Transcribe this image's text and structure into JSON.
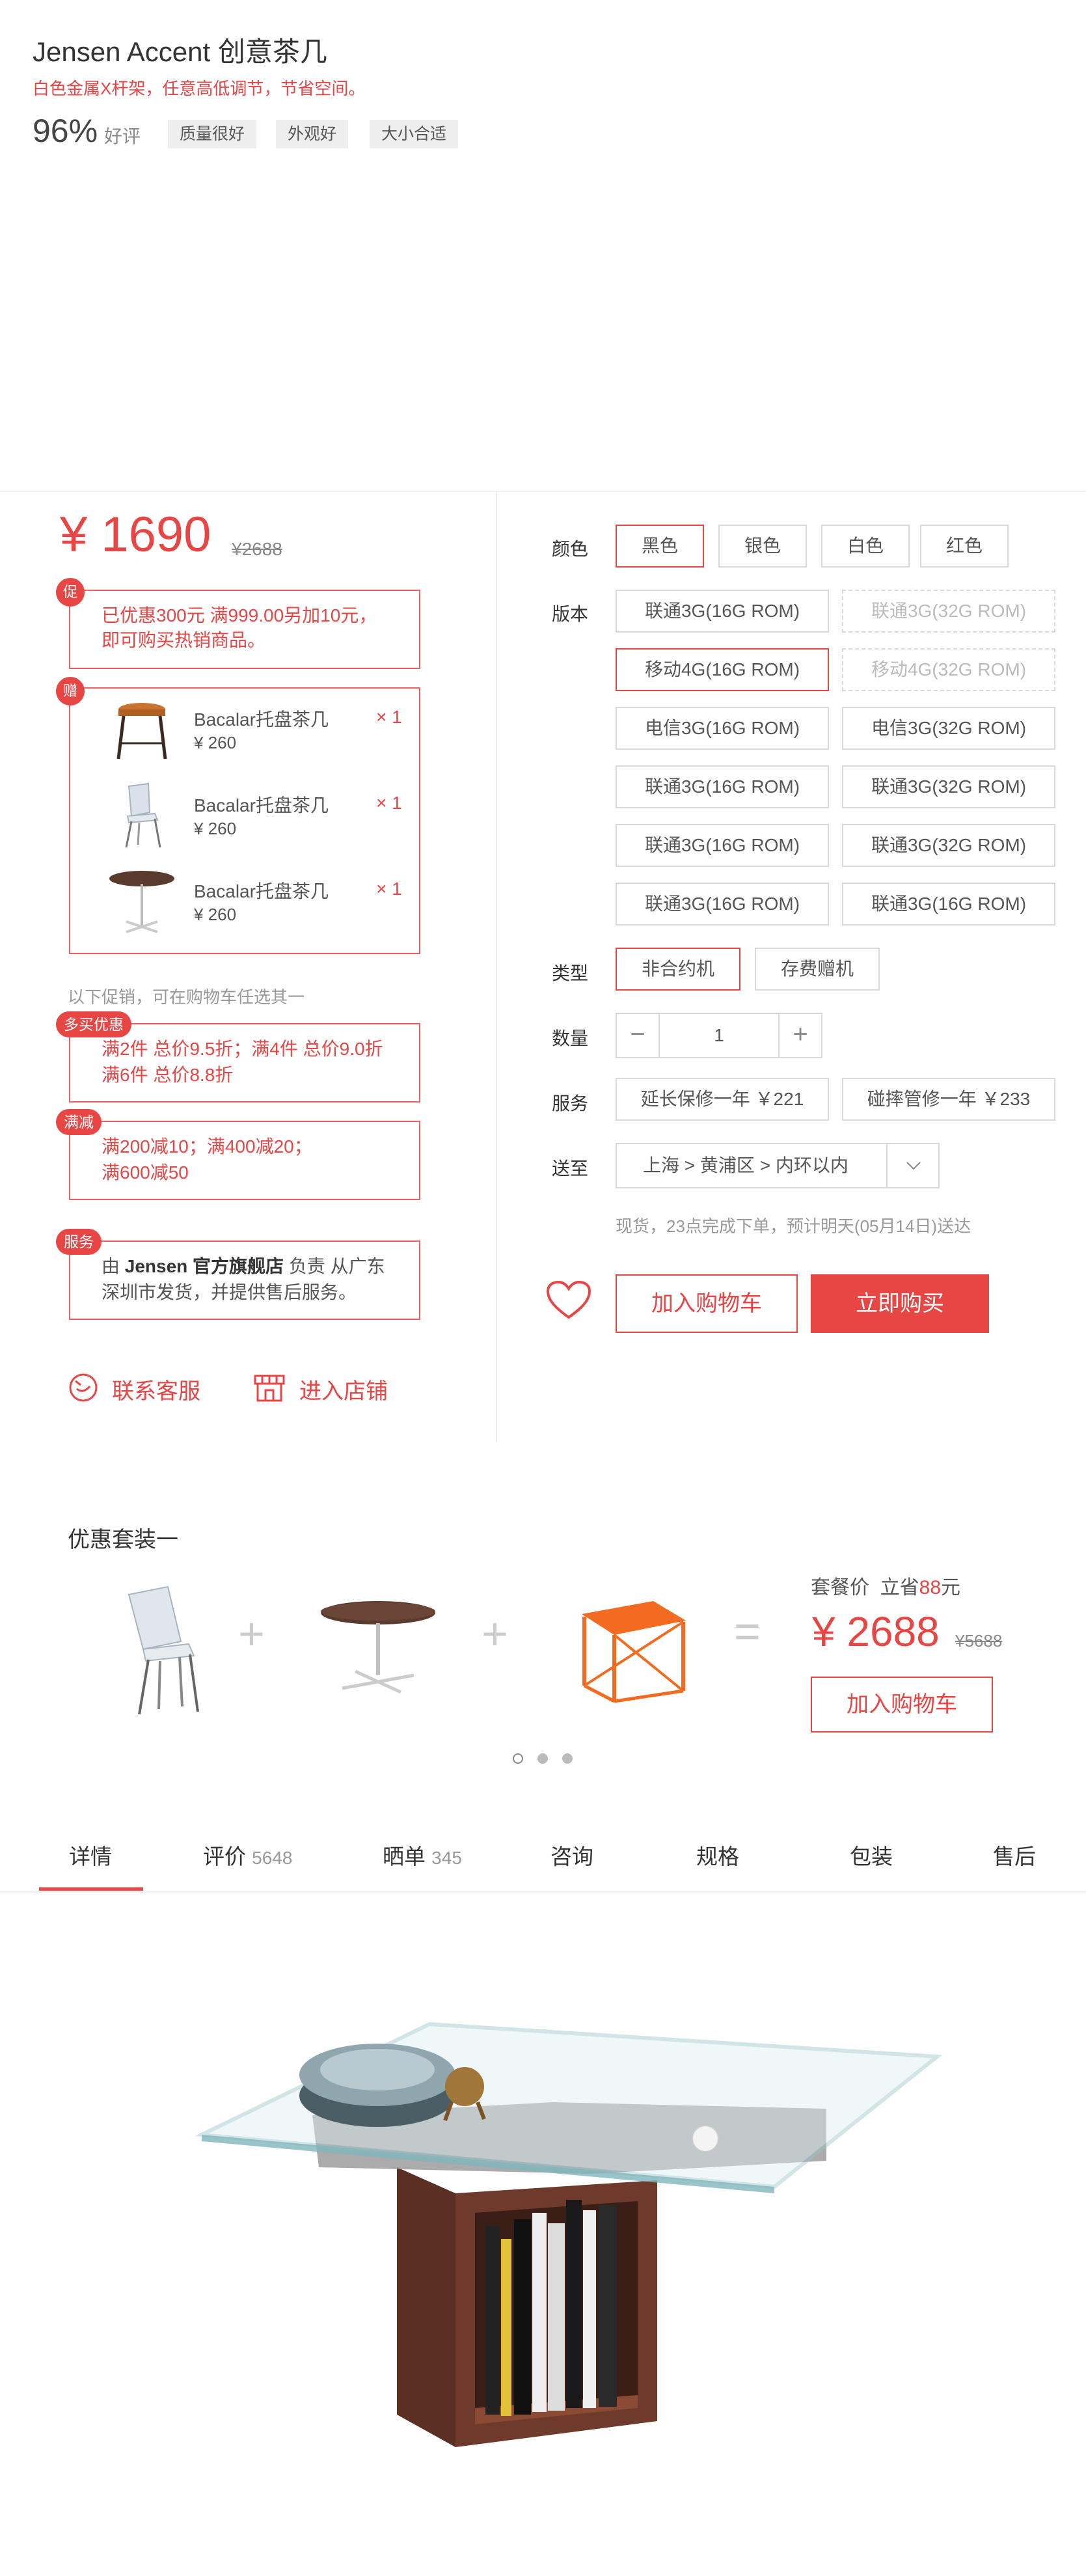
{
  "product": {
    "title": "Jensen Accent 创意茶几",
    "subtitle": "白色金属X杆架，任意高低调节，节省空间。",
    "rating": "96%",
    "rating_label": "好评",
    "tags": [
      "质量很好",
      "外观好",
      "大小合适"
    ]
  },
  "price": {
    "current": "¥ 1690",
    "original": "¥2688"
  },
  "promotions": {
    "discount_badge": "促",
    "discount_text_1": "已优惠300元   满999.00另加10元，",
    "discount_text_2": "即可购买热销商品。",
    "gift_badge": "赠",
    "gifts": [
      {
        "name": "Bacalar托盘茶几",
        "price": "¥ 260",
        "qty": "× 1"
      },
      {
        "name": "Bacalar托盘茶几",
        "price": "¥ 260",
        "qty": "× 1"
      },
      {
        "name": "Bacalar托盘茶几",
        "price": "¥ 260",
        "qty": "× 1"
      }
    ],
    "note": "以下促销，可在购物车任选其一",
    "multi_badge": "多买优惠",
    "multi_text_1": "满2件 总价9.5折；满4件 总价9.0折",
    "multi_text_2": "满6件 总价8.8折",
    "reduce_badge": "满减",
    "reduce_text_1": "满200减10；满400减20；",
    "reduce_text_2": "满600减50",
    "service_badge": "服务",
    "service_prefix": "由 ",
    "service_shop": "Jensen 官方旗舰店",
    "service_text_1": " 负责 从广东",
    "service_text_2": "深圳市发货，并提供售后服务。"
  },
  "contact": {
    "service_label": "联系客服",
    "store_label": "进入店铺"
  },
  "options": {
    "color_label": "颜色",
    "colors": [
      "黑色",
      "银色",
      "白色",
      "红色"
    ],
    "version_label": "版本",
    "versions": [
      [
        "联通3G(16G ROM)",
        "联通3G(32G ROM)"
      ],
      [
        "移动4G(16G ROM)",
        "移动4G(32G ROM)"
      ],
      [
        "电信3G(16G ROM)",
        "电信3G(32G ROM)"
      ],
      [
        "联通3G(16G ROM)",
        "联通3G(32G ROM)"
      ],
      [
        "联通3G(16G ROM)",
        "联通3G(32G ROM)"
      ],
      [
        "联通3G(16G ROM)",
        "联通3G(16G ROM)"
      ]
    ],
    "type_label": "类型",
    "types": [
      "非合约机",
      "存费赠机"
    ],
    "qty_label": "数量",
    "qty_minus": "−",
    "qty_value": "1",
    "qty_plus": "+",
    "service_label": "服务",
    "services": [
      "延长保修一年 ￥221",
      "碰摔管修一年 ￥233"
    ],
    "ship_label": "送至",
    "ship_value": "上海 > 黄浦区 > 内环以内",
    "delivery": "现货，23点完成下单，预计明天(05月14日)送达",
    "add_cart": "加入购物车",
    "buy_now": "立即购买"
  },
  "bundle": {
    "title": "优惠套装一",
    "price_label": "套餐价",
    "save_prefix": "立省",
    "save_amount": "88",
    "save_unit": "元",
    "price": "¥ 2688",
    "original": "¥5688",
    "add_cart": "加入购物车",
    "plus": "+",
    "equals": "="
  },
  "tabs": [
    {
      "label": "详情",
      "count": ""
    },
    {
      "label": "评价",
      "count": "5648"
    },
    {
      "label": "晒单",
      "count": "345"
    },
    {
      "label": "咨询",
      "count": ""
    },
    {
      "label": "规格",
      "count": ""
    },
    {
      "label": "包装",
      "count": ""
    },
    {
      "label": "售后",
      "count": ""
    }
  ],
  "colors": {
    "accent": "#e84545",
    "border": "#d9d9d9"
  }
}
